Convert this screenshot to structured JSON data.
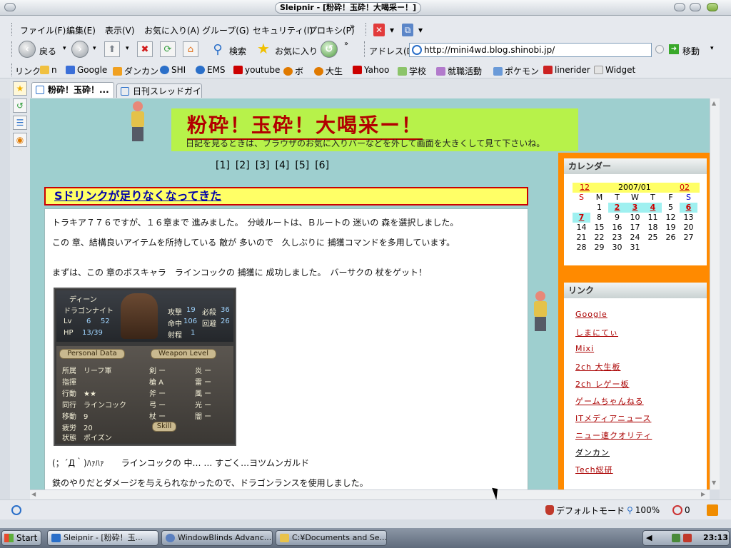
{
  "window": {
    "title": "Sleipnir - [粉砕！玉砕！大喝采ー！]"
  },
  "menu": {
    "items": [
      "ファイル(F)",
      "編集(E)",
      "表示(V)",
      "お気に入り(A)",
      "グループ(G)",
      "セキュリティ(I)",
      "プロキシ(P)"
    ],
    "more": "»"
  },
  "nav": {
    "back_label": "戻る",
    "search_label": "検索",
    "favorites_label": "お気に入り",
    "address_label": "アドレス(D)",
    "address_value": "http://mini4wd.blog.shinobi.jp/",
    "go_label": "移動"
  },
  "links_bar": {
    "label": "リンク",
    "items": [
      {
        "label": "n",
        "icon": "page-icon",
        "color": "#f0c040"
      },
      {
        "label": "Google",
        "icon": "google-icon",
        "color": "#3b6fd8"
      },
      {
        "label": "ダンカン",
        "icon": "page-icon",
        "color": "#f0a020"
      },
      {
        "label": "SHI",
        "icon": "ie-icon",
        "color": "#2a6fc9"
      },
      {
        "label": "EMS",
        "icon": "ie-icon",
        "color": "#2a6fc9"
      },
      {
        "label": "youtube",
        "icon": "youtube-icon",
        "color": "#cc0000"
      },
      {
        "label": "ボ",
        "icon": "help-icon",
        "color": "#e07a00"
      },
      {
        "label": "大生",
        "icon": "help-icon",
        "color": "#e07a00"
      },
      {
        "label": "Yahoo",
        "icon": "yahoo-icon",
        "color": "#cc0000"
      },
      {
        "label": "学校",
        "icon": "folder-icon",
        "color": "#8cc46a"
      },
      {
        "label": "就職活動",
        "icon": "folder-icon",
        "color": "#b27acc"
      },
      {
        "label": "ポケモン",
        "icon": "folder-icon",
        "color": "#6a9ad8"
      },
      {
        "label": "linerider",
        "icon": "page-icon",
        "color": "#cc2222"
      },
      {
        "label": "Widget",
        "icon": "folder-icon",
        "color": "#d8d8d8"
      }
    ]
  },
  "tabs": [
    {
      "label": "粉砕！玉砕！...",
      "active": true
    },
    {
      "label": "日刊スレッドガイド",
      "active": false
    }
  ],
  "page": {
    "header_title": "粉砕！玉砕！大喝采ー！",
    "header_sub": "日記を見るときは、ブラウザのお気に入りバーなどを外して画面を大きくして見て下さいね。",
    "pager": [
      "[1]",
      "[2]",
      "[3]",
      "[4]",
      "[5]",
      "[6]"
    ],
    "post_title": "Sドリンクが足りなくなってきた",
    "lines": [
      "トラキア７７６ですが、１６章まで 進みました。　分岐ルートは、Ｂルートの 迷いの 森を選択しました。",
      "この 章、結構良いアイテムを所持している 敵が 多いので　久しぶりに 捕獲コマンドを多用しています。",
      "まずは、この 章のボスキャラ　ラインコックの 捕獲に 成功しました。　バーサクの 杖をゲット！",
      "(；´Д｀)ﾊｧﾊｧ　　ラインコックの 中… … すごく…ヨツムンガルド",
      "鉄のやりだとダメージを与えられなかったので、ドラゴンランスを使用しました。"
    ],
    "game": {
      "name": "ディーン",
      "class": "ドラゴンナイト",
      "lv_label": "Lv",
      "lv_value": "6",
      "exp": "52",
      "hp_label": "HP",
      "hp_value": "13/39",
      "atk_label": "攻撃",
      "atk_value": "19",
      "crit_label": "必殺",
      "crit_value": "36",
      "hit_label": "命中",
      "hit_value": "106",
      "avo_label": "回避",
      "avo_value": "26",
      "rng_label": "射程",
      "rng_value": "1",
      "personal_header": "Personal Data",
      "weapon_header": "Weapon Level",
      "personal_rows": [
        "所属　リーフ軍",
        "指揮",
        "行動　★★",
        "同行　ラインコック",
        "移動　9",
        "疲労　20",
        "状態　ポイズン"
      ],
      "weapon_rows": [
        "剣 ー",
        "槍 A",
        "斧 ー",
        "弓 ー",
        "杖 ー"
      ],
      "weapon_rows2": [
        "炎 ー",
        "雷 ー",
        "風 ー",
        "光 ー",
        "闇 ー"
      ],
      "skill_label": "Skill"
    }
  },
  "calendar": {
    "title": "カレンダー",
    "prev": "12",
    "month": "2007/01",
    "next": "02",
    "weekdays": [
      "S",
      "M",
      "T",
      "W",
      "T",
      "F",
      "S"
    ],
    "weeks": [
      [
        "",
        "1",
        "2",
        "3",
        "4",
        "5",
        "6"
      ],
      [
        "7",
        "8",
        "9",
        "10",
        "11",
        "12",
        "13"
      ],
      [
        "14",
        "15",
        "16",
        "17",
        "18",
        "19",
        "20"
      ],
      [
        "21",
        "22",
        "23",
        "24",
        "25",
        "26",
        "27"
      ],
      [
        "28",
        "29",
        "30",
        "31",
        "",
        "",
        ""
      ]
    ],
    "highlighted": [
      "2",
      "3",
      "4",
      "6",
      "7"
    ]
  },
  "links_widget": {
    "title": "リンク",
    "items": [
      "Google",
      "しまにてぃ",
      "Mixi",
      "2ch 大生板",
      "2ch レゲー板",
      "ゲームちゃんねる",
      "ITメディアニュース",
      "ニュー速クオリティ",
      "ダンカン",
      "Tech総研"
    ]
  },
  "status": {
    "mode": "デフォルトモード",
    "zoom": "100%",
    "count": "0"
  },
  "taskbar": {
    "start": "Start",
    "items": [
      "Sleipnir - [粉砕！玉...",
      "WindowBlinds Advanc...",
      "C:¥Documents and Se..."
    ],
    "clock": "23:13"
  },
  "colors": {
    "page_bg": "#9ecfcf",
    "header_bg": "#b7f24a",
    "header_title": "#b20000",
    "post_title_bg": "#ffff66",
    "sidebar": "#ff8a00"
  }
}
